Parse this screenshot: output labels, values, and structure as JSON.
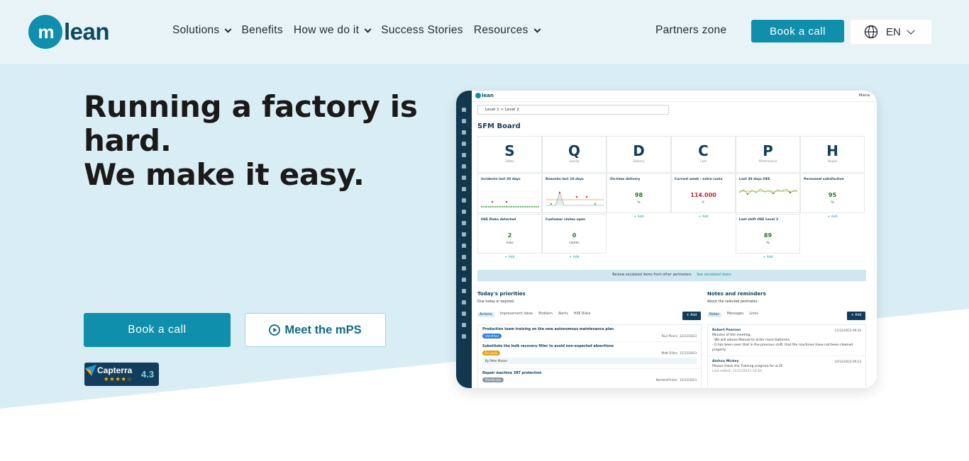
{
  "brand": {
    "logo_mark": "m",
    "logo_text": "lean",
    "accent": "#0f8fab",
    "dark": "#123d5c"
  },
  "nav": {
    "items": [
      {
        "label": "Solutions",
        "has_dropdown": true
      },
      {
        "label": "Benefits",
        "has_dropdown": false
      },
      {
        "label": "How we do it",
        "has_dropdown": true
      },
      {
        "label": "Success Stories",
        "has_dropdown": false
      },
      {
        "label": "Resources",
        "has_dropdown": true
      }
    ],
    "partners": "Partners zone",
    "book": "Book a call",
    "lang": "EN",
    "lang_icon": "globe-icon"
  },
  "hero": {
    "line1": "Running a factory is",
    "line2": "hard.",
    "line3": "We make it easy.",
    "book": "Book a call",
    "meet": "Meet the mPS",
    "meet_icon": "play-circle-icon",
    "capterra": {
      "name": "Capterra",
      "score": "4.3",
      "stars": "★★★★☆"
    }
  },
  "app": {
    "logo": "lean",
    "user": "Maria",
    "breadcrumb": "Level 1  >  Level 2",
    "title": "SFM Board",
    "columns": [
      {
        "letter": "S",
        "sub": "Safety"
      },
      {
        "letter": "Q",
        "sub": "Quality"
      },
      {
        "letter": "D",
        "sub": "Delivery"
      },
      {
        "letter": "C",
        "sub": "Cost"
      },
      {
        "letter": "P",
        "sub": "Performance"
      },
      {
        "letter": "H",
        "sub": "People"
      }
    ],
    "kpis_row1": [
      {
        "title": "Incidents last 30 days"
      },
      {
        "title": "Reworks last 10 days"
      },
      {
        "title": "On-time delivery",
        "value": "98",
        "unit": "%"
      },
      {
        "title": "Current week - extra costs",
        "value": "114.000",
        "unit": "€",
        "status": "bad"
      },
      {
        "title": "Last 30 days OEE"
      },
      {
        "title": "Personnel satisfaction",
        "value": "95",
        "unit": "%"
      }
    ],
    "kpis_row2": [
      {
        "title": "HSE Risks detected",
        "value": "2",
        "unit": "risks"
      },
      {
        "title": "Customer claims open",
        "value": "0",
        "unit": "claims"
      },
      {
        "title": "Last shift OEE Level 2",
        "value": "89",
        "unit": "%"
      }
    ],
    "add_label": "+ Add",
    "escalated": "Review escalated items from other perimeters",
    "escalated_link": "See escalated items",
    "priorities": {
      "title": "Today's priorities",
      "sub": "Due today or expired.",
      "tabs": [
        "Actions",
        "Improvement Ideas",
        "Problem",
        "Alerts",
        "HSE Risks"
      ],
      "add": "+ Add",
      "rows": [
        {
          "title": "Production team training on the new autonomous maintenance plan",
          "who": "Paul Pierce",
          "date": "12/12/2023",
          "chip": "Identified",
          "chip_color": "#2f7fd6"
        },
        {
          "title": "Substitute the bulk recovery filter to avoid non-expected absortions",
          "who": "Matt Dillon",
          "date": "11/12/2023",
          "chip": "En curso",
          "chip_color": "#e6a11a",
          "by": "By Peter Mason"
        },
        {
          "title": "Repair machine 3RT protection",
          "who": "NombrePrinter",
          "date": "12/12/2023",
          "chip": "Planificada",
          "chip_color": "#8a98a3"
        }
      ]
    },
    "notes": {
      "title": "Notes and reminders",
      "sub": "About the selected perimeter.",
      "tabs": [
        "Notes",
        "Messages",
        "Links"
      ],
      "add": "+ Add",
      "rows": [
        {
          "author": "Robert Pearson",
          "date": "11/12/2023  09:34",
          "lines": [
            "Minutes of the meeting:",
            "- We will advise Manuel to order more batteries.",
            "- It has been seen that in the previous shift, that the machines have not been cleaned",
            "properly."
          ]
        },
        {
          "author": "Ainhoa Mickey",
          "date": "10/12/2023  09:23",
          "lines": [
            "Please check the Training program for w.35",
            "Last edited: 11/12/2023 16:40"
          ]
        }
      ]
    }
  }
}
